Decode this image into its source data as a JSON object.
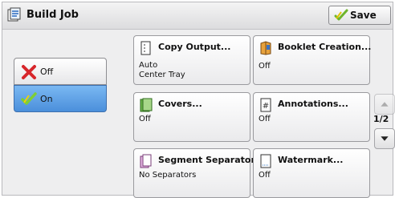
{
  "header": {
    "title": "Build Job",
    "save_label": "Save"
  },
  "toggle": {
    "off_label": "Off",
    "on_label": "On",
    "selected": "On"
  },
  "tiles": [
    {
      "name": "Copy Output...",
      "values": [
        "Auto",
        "Center Tray"
      ],
      "icon": "copy-output-icon"
    },
    {
      "name": "Booklet Creation...",
      "values": [
        "Off"
      ],
      "icon": "booklet-icon"
    },
    {
      "name": "Covers...",
      "values": [
        "Off"
      ],
      "icon": "covers-icon"
    },
    {
      "name": "Annotations...",
      "values": [
        "Off"
      ],
      "icon": "annotations-icon"
    },
    {
      "name": "Segment Separators...",
      "values": [
        "No Separators"
      ],
      "icon": "segment-separators-icon"
    },
    {
      "name": "Watermark...",
      "values": [
        "Off"
      ],
      "icon": "watermark-icon"
    }
  ],
  "pager": {
    "indicator": "1/2"
  },
  "colors": {
    "selected": "#5a9be6",
    "off_x": "#d7262b",
    "check": "#6fb52c"
  }
}
